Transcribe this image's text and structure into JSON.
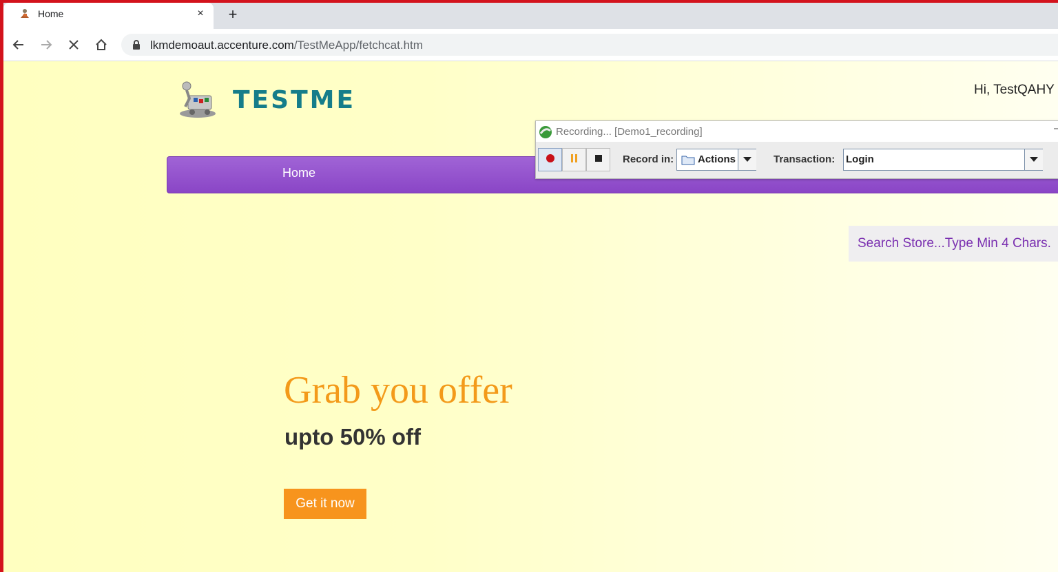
{
  "browser": {
    "tab_title": "Home",
    "close_tab_symbol": "×",
    "new_tab_symbol": "+",
    "url_host": "lkmdemoaut.accenture.com",
    "url_path": "/TestMeApp/fetchcat.htm"
  },
  "header": {
    "logo_text": "TESTME",
    "greeting": "Hi, TestQAHY"
  },
  "nav": {
    "home_label": "Home"
  },
  "search": {
    "placeholder": "Search Store...Type Min 4 Chars."
  },
  "banner": {
    "title": "Grab you offer",
    "subtitle": "upto 50% off",
    "cta_label": "Get it now"
  },
  "recorder": {
    "title": "Recording... [Demo1_recording]",
    "record_in_label": "Record in:",
    "record_in_value": "Actions",
    "transaction_label": "Transaction:",
    "transaction_value": "Login"
  },
  "colors": {
    "accent_purple": "#8a45c6",
    "offer_orange": "#f39a1a",
    "logo_teal": "#157d8a"
  }
}
